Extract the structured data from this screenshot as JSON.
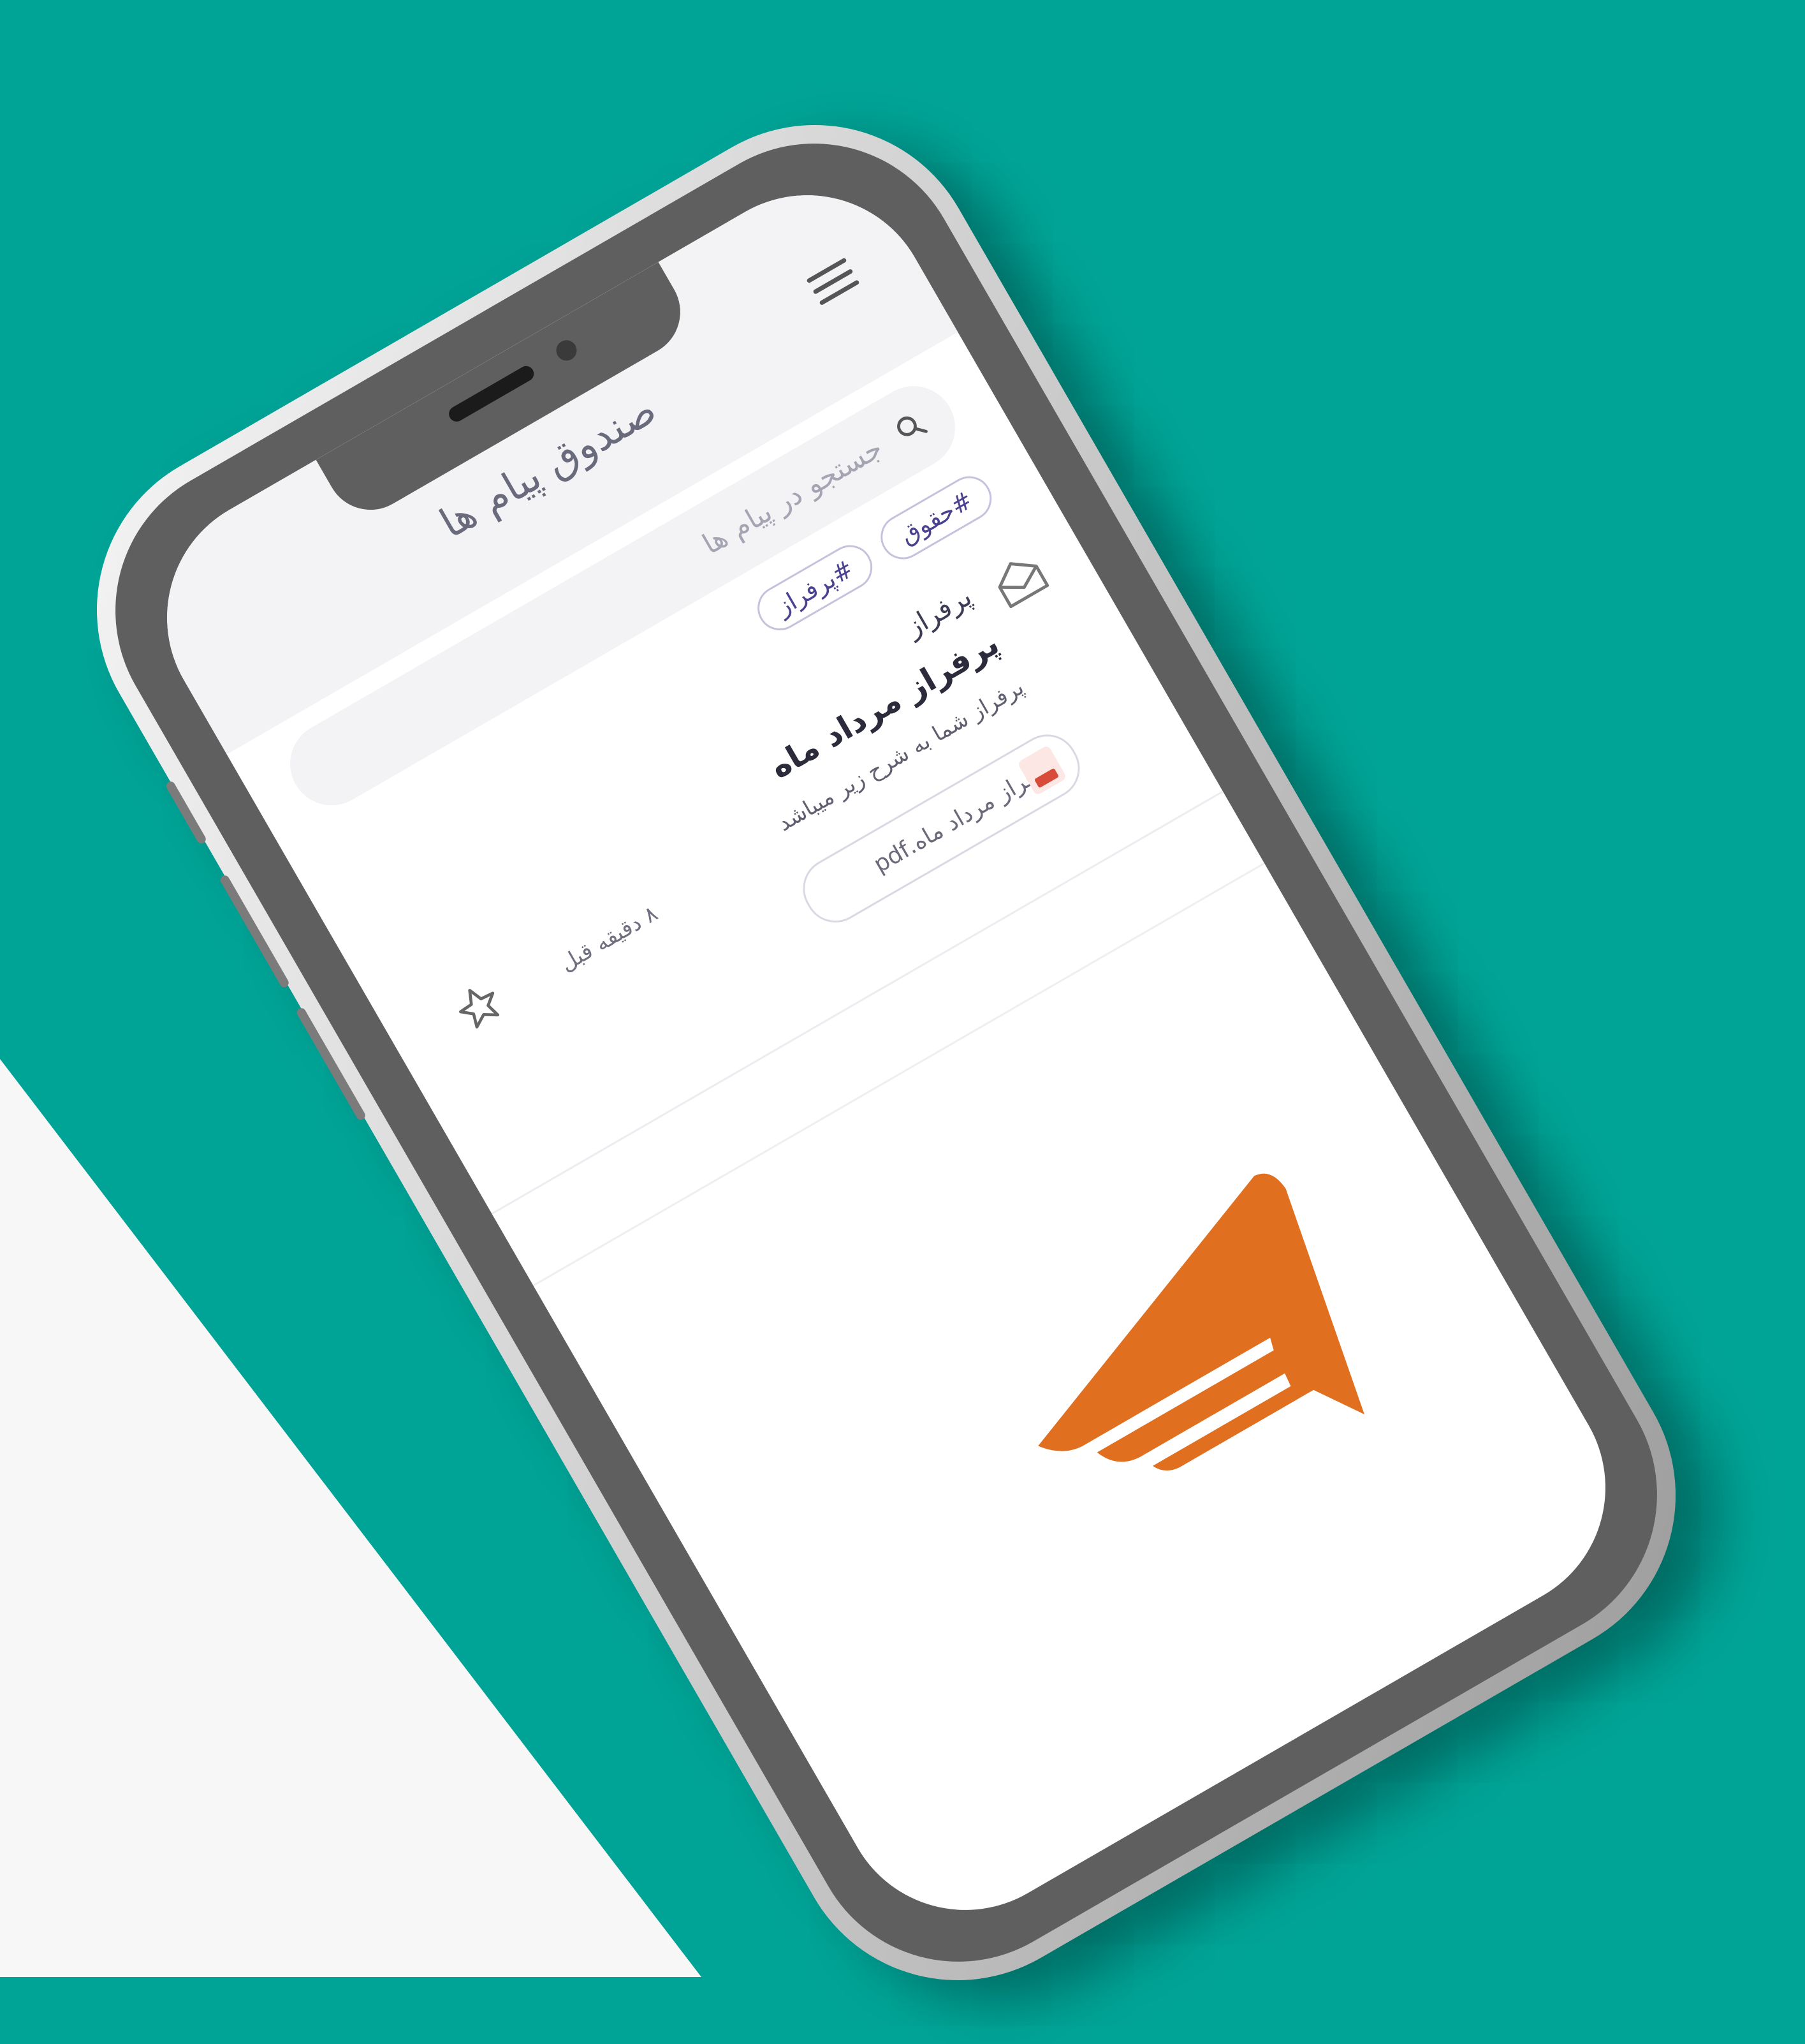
{
  "app": {
    "title": "صندوق پیام ها",
    "menu_icon": "hamburger-menu-icon"
  },
  "search": {
    "placeholder": "جستجو در پیام ها",
    "icon": "search-icon"
  },
  "tags": [
    "#حقوق",
    "#پرفراز"
  ],
  "messages": [
    {
      "sender": "پرفراز",
      "subject": "پرفراز مرداد ماه",
      "preview": "پرفراز شما به شرح زیر میباشد",
      "attachment": "پرفراز مرداد ماه.pdf",
      "time": "۸ دقیقه قبل",
      "icon": "open-envelope-icon",
      "starred": false
    }
  ],
  "colors": {
    "background": "#00a497",
    "accent_logo": "#e07020",
    "tag_text": "#4a4290"
  }
}
